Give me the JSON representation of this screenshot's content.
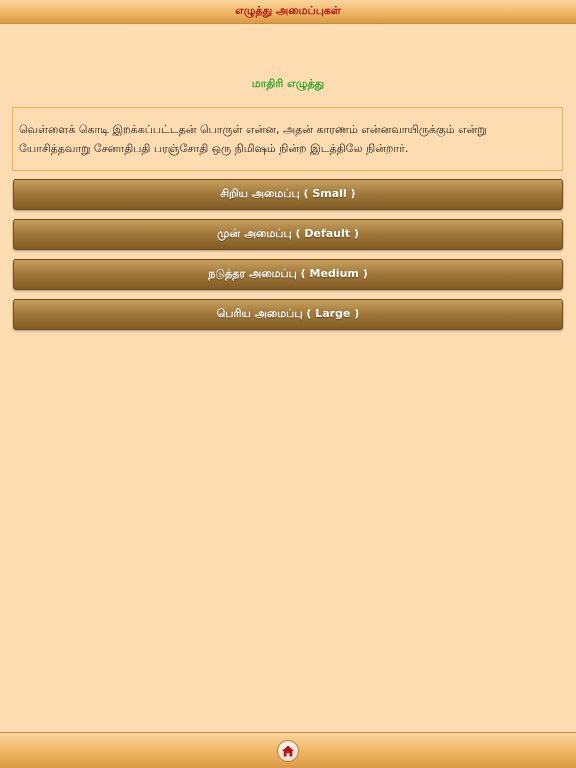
{
  "header": {
    "title": "எழுத்து அமைப்புகள்"
  },
  "sample": {
    "heading": "மாதிரி எழுத்து",
    "text": "வெள்ளைக் கொடி இறக்கப்பட்டதன் பொருள் என்ன, அதன் காரணம் என்னவாயிருக்கும் என்று யோசித்தவாறு சேனாதிபதி பரஞ்சோதி ஒரு நிமிஷம் நின்ற இடத்திலே நின்றார்."
  },
  "buttons": {
    "small": "சிறிய அமைப்பு ( Small )",
    "default": "முன் அமைப்பு ( Default )",
    "medium": "நடுத்தர அமைப்பு ( Medium )",
    "large": "பெரிய அமைப்பு ( Large )"
  },
  "footer": {
    "home_icon": "home-icon"
  },
  "colors": {
    "background": "#fddcb2",
    "title_text": "#b01010",
    "heading_text": "#2aa82a",
    "button": "#a27a3c",
    "home_icon": "#c0101a"
  }
}
